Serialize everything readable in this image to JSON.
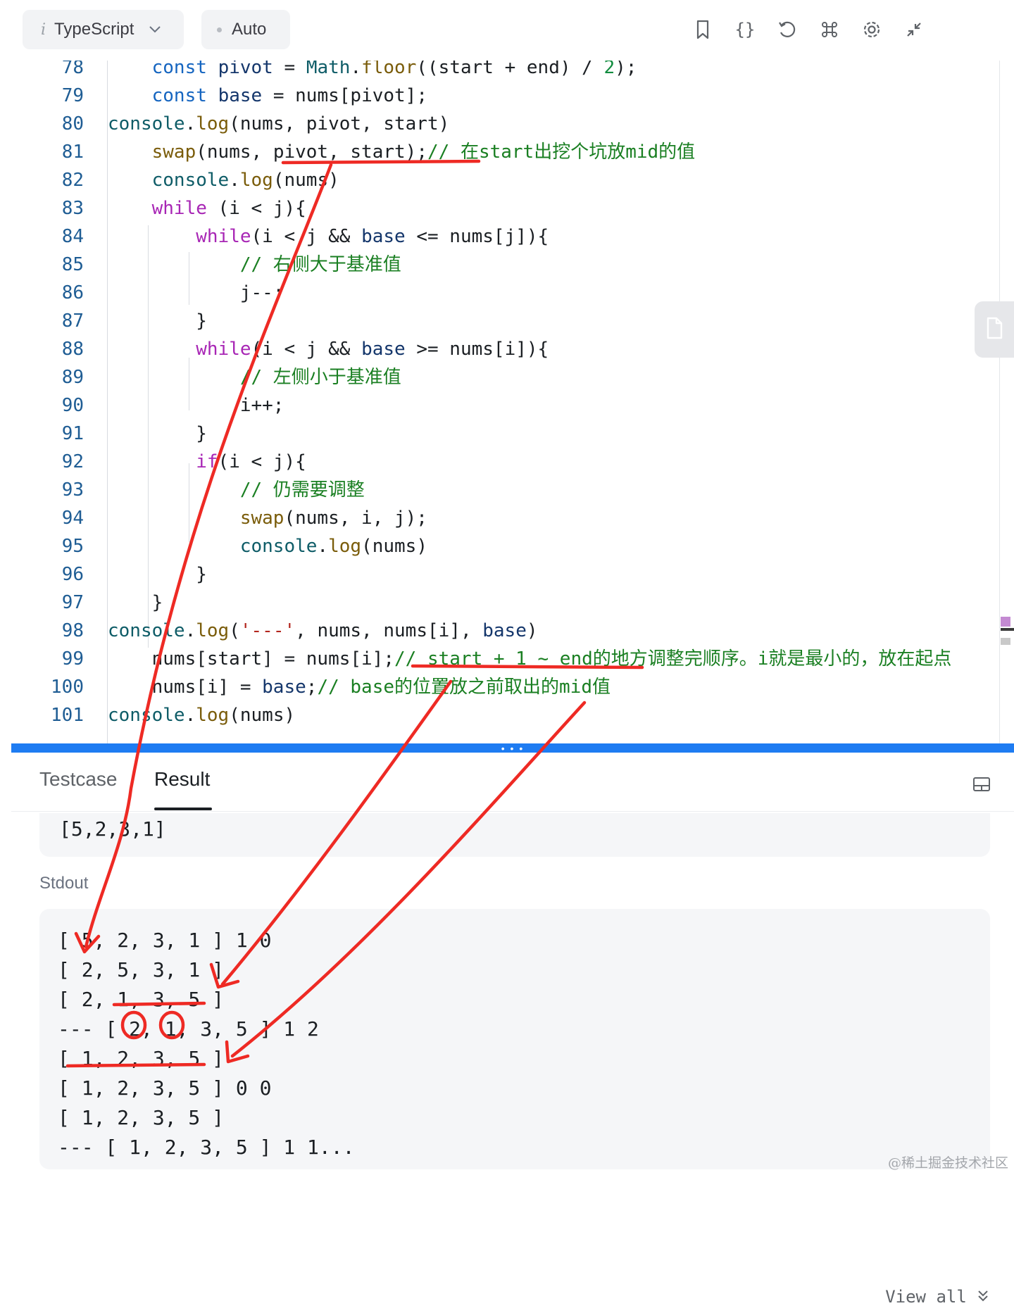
{
  "toolbar": {
    "language_icon": "i",
    "language": "TypeScript",
    "mode": "Auto",
    "icons": [
      "bookmark-icon",
      "braces-icon",
      "reset-icon",
      "command-icon",
      "settings-icon",
      "collapse-icon"
    ]
  },
  "editor": {
    "line_numbers": [
      "78",
      "79",
      "80",
      "81",
      "82",
      "83",
      "84",
      "85",
      "86",
      "87",
      "88",
      "89",
      "90",
      "91",
      "92",
      "93",
      "94",
      "95",
      "96",
      "97",
      "98",
      "99",
      "100",
      "101"
    ]
  },
  "panel": {
    "tabs": [
      "Testcase",
      "Result"
    ],
    "active_tab": "Result",
    "input": "[5,2,3,1]",
    "stdout_label": "Stdout",
    "stdout_lines": [
      "[ 5, 2, 3, 1 ] 1 0",
      "[ 2, 5, 3, 1 ]",
      "[ 2, 1, 3, 5 ]",
      "--- [ 2, 1, 3, 5 ] 1 2",
      "[ 1, 2, 3, 5 ]",
      "[ 1, 2, 3, 5 ] 0 0",
      "[ 1, 2, 3, 5 ]",
      "--- [ 1, 2, 3, 5 ] 1 1..."
    ],
    "view_all": "View all"
  },
  "watermark": "@稀土掘金技术社区",
  "colors": {
    "accent": "#1e7cf2",
    "annotation": "#ee2a24",
    "comment": "#1a7f22"
  }
}
